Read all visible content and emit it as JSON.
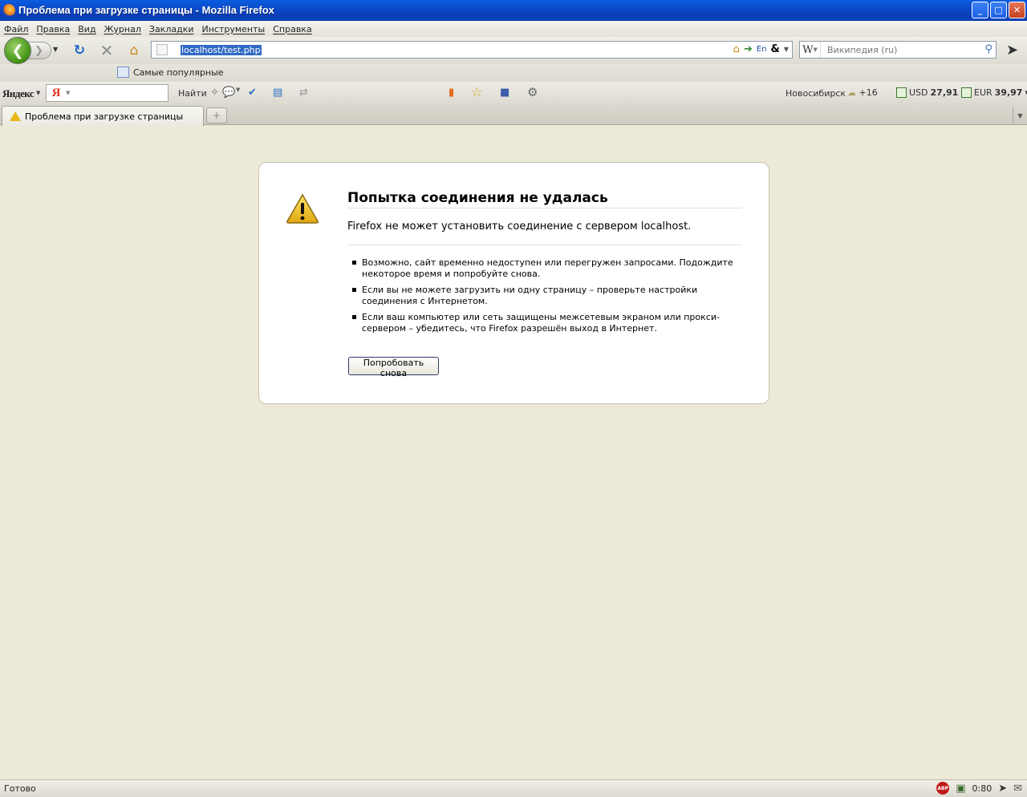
{
  "window": {
    "title": "Проблема при загрузке страницы - Mozilla Firefox",
    "controls": {
      "minimize": "_",
      "maximize": "□",
      "close": "✕"
    }
  },
  "menu": [
    "Файл",
    "Правка",
    "Вид",
    "Журнал",
    "Закладки",
    "Инструменты",
    "Справка"
  ],
  "navbar": {
    "url": "localhost/test.php",
    "search_placeholder": "Википедия (ru)",
    "search_engine_glyph": "W",
    "url_extras": {
      "lang": "En",
      "amp": "&"
    }
  },
  "bookmarks": {
    "most_visited": "Самые популярные"
  },
  "yandex": {
    "logo": "Яндекс",
    "logo_red": "Я",
    "find": "Найти",
    "city": "Новосибирск",
    "temperature": "+16",
    "usd_label": "USD",
    "usd_value": "27,91",
    "eur_label": "EUR",
    "eur_value": "39,97"
  },
  "tabs": [
    {
      "label": "Проблема при загрузке страницы",
      "active": true
    }
  ],
  "error": {
    "title": "Попытка соединения не удалась",
    "description": "Firefox не может установить соединение с сервером localhost.",
    "bullets": [
      "Возможно, сайт временно недоступен или перегружен запросами. Подождите некоторое время и попробуйте снова.",
      "Если вы не можете загрузить ни одну страницу – проверьте настройки соединения с Интернетом.",
      "Если ваш компьютер или сеть защищены межсетевым экраном или прокси-сервером – убедитесь, что Firefox разрешён выход в Интернет."
    ],
    "retry_button": "Попробовать снова"
  },
  "status": {
    "text": "Готово",
    "time": "0:80",
    "abp": "ABP"
  },
  "icons": {
    "back": "back-arrow-icon",
    "forward": "forward-arrow-icon",
    "reload": "reload-icon",
    "stop": "stop-icon",
    "home": "home-icon",
    "warning": "warning-icon"
  },
  "colors": {
    "titlebar": "#0b48c9",
    "content_bg": "#ece9d8",
    "url_highlight": "#316ac5",
    "warning": "#e8b817"
  }
}
